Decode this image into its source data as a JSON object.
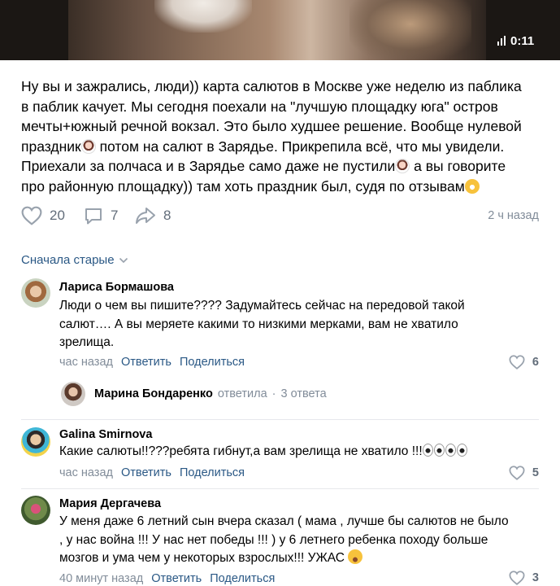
{
  "video": {
    "duration": "0:11"
  },
  "post": {
    "lines": [
      "Ну вы и зажрались, люди)) карта салютов в Москве уже неделю из паблика",
      "в паблик качует. Мы сегодня поехали на \"лучшую площадку юга\" остров",
      "мечты+южный речной вокзал. Это было худшее решение. Вообще нулевой",
      "праздник",
      " потом на салют в Зарядье. Прикрепила всё, что мы увидели.",
      "Приехали за полчаса и в Зарядье само даже не пустили",
      " а вы говорите",
      "про районную площадку)) там хоть праздник был, судя по отзывам"
    ],
    "likes": "20",
    "comments": "7",
    "shares": "8",
    "time": "2 ч назад"
  },
  "sort_label": "Сначала старые",
  "comments": [
    {
      "author": "Лариса Бормашова",
      "lines": [
        "Люди о чем вы пишите???? Задумайтесь сейчас на передовой такой",
        "салют…. А вы меряете какими то низкими мерками, вам не хватило",
        "зрелища."
      ],
      "time": "час назад",
      "reply": "Ответить",
      "share": "Поделиться",
      "likes": "6"
    },
    {
      "author": "Galina Smirnova",
      "lines": [
        "Какие салюты!!???ребята гибнут,а вам зрелища не хватило !!!"
      ],
      "time": "час назад",
      "reply": "Ответить",
      "share": "Поделиться",
      "likes": "5"
    },
    {
      "author": "Мария Дергачева",
      "lines": [
        "У меня даже 6 летний сын вчера сказал ( мама , лучше бы салютов не было",
        ", у нас война !!! У нас нет победы !!! ) у 6 летнего ребенка походу больше",
        "мозгов и ума чем у некоторых взрослых!!! УЖАС"
      ],
      "time": "40 минут назад",
      "reply": "Ответить",
      "share": "Поделиться",
      "likes": "3"
    }
  ],
  "reply_thread": {
    "name": "Марина Бондаренко",
    "action": "ответила",
    "separator": "·",
    "count": "3 ответа"
  },
  "colors": {
    "link": "#2a5885",
    "muted": "#818c99",
    "icon": "#626d7a"
  }
}
